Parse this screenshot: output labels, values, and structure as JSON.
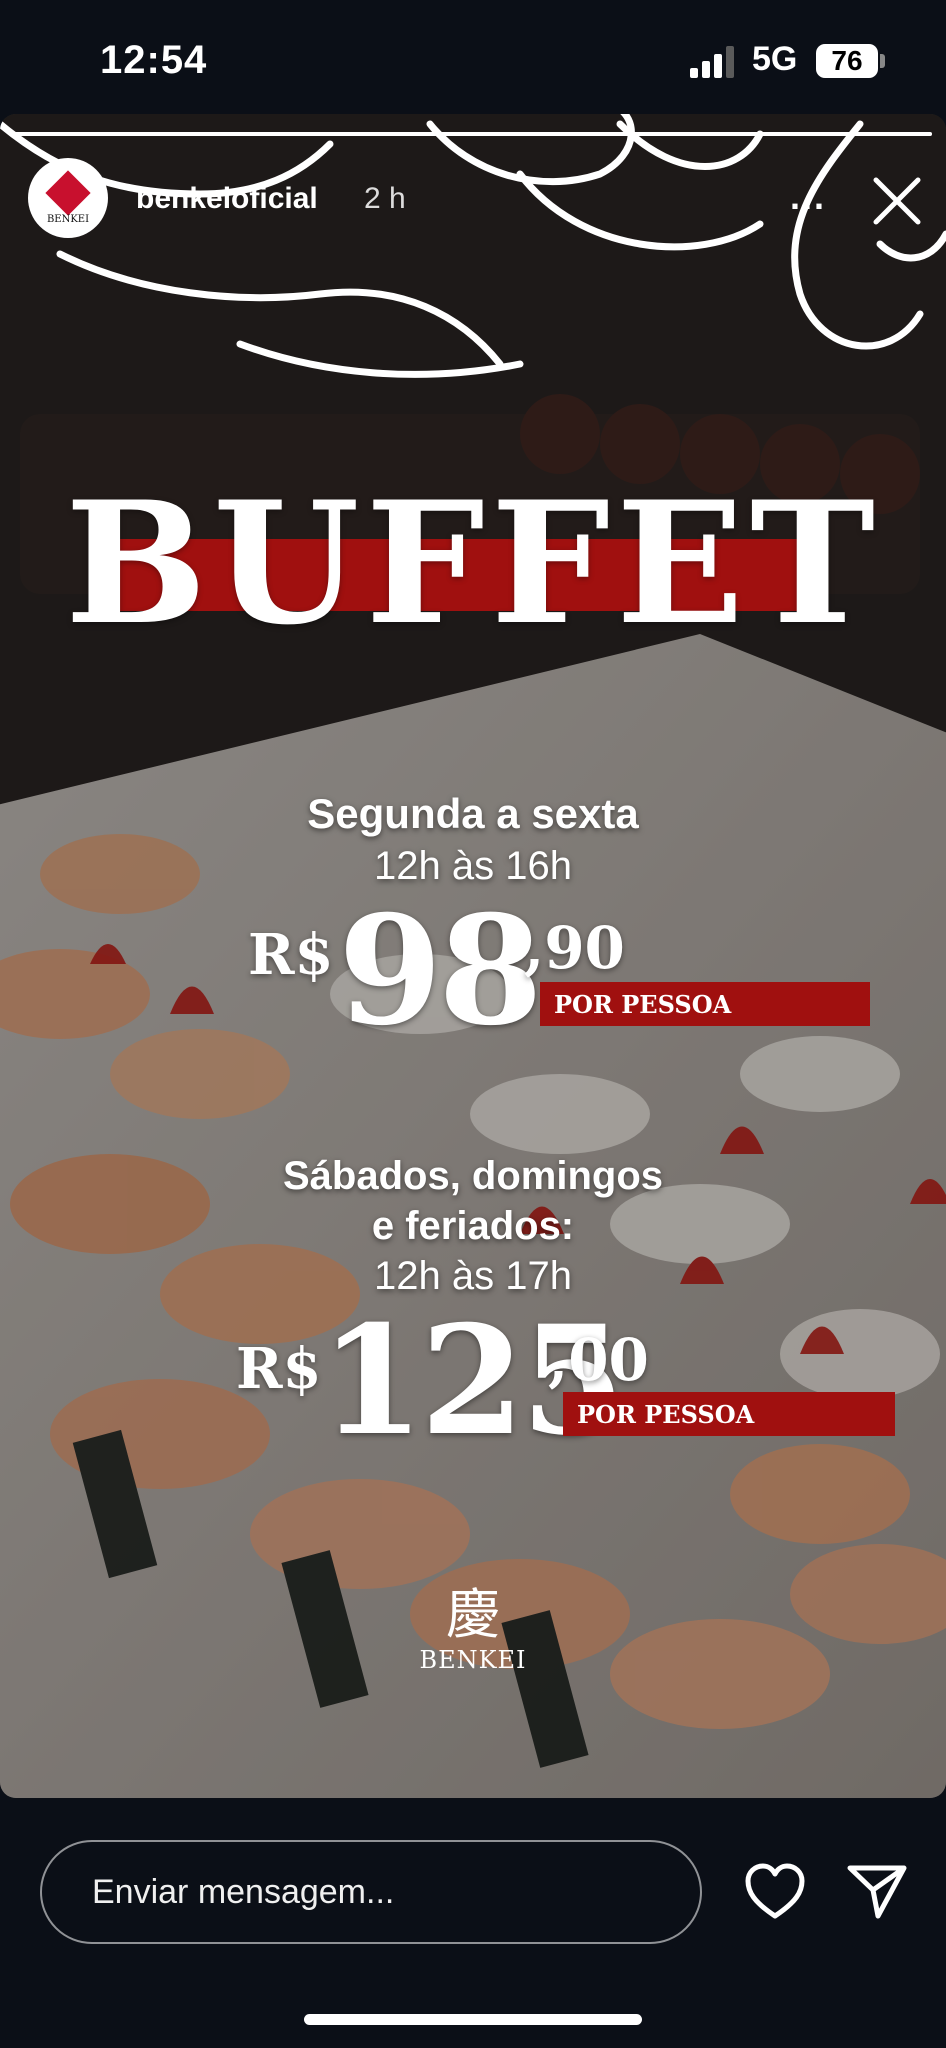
{
  "status_bar": {
    "time": "12:54",
    "network": "5G",
    "battery": "76"
  },
  "story": {
    "progress": 1.0,
    "account": {
      "username": "benkeioficial",
      "posted": "2 h",
      "avatar_text": "BENKEI",
      "avatar_color": "#c8102e"
    },
    "more_label": "...",
    "content": {
      "title": "BUFFET",
      "weekday": {
        "days": "Segunda a sexta",
        "hours": "12h às 16h",
        "currency": "R$",
        "amount": "98",
        "cents": ",90",
        "unit": "POR PESSOA"
      },
      "weekend": {
        "days_line1": "Sábados, domingos",
        "days_line2": "e feriados:",
        "hours": "12h às 17h",
        "currency": "R$",
        "amount": "125",
        "cents": ",00",
        "unit": "POR PESSOA"
      },
      "logo_glyph": "慶",
      "logo_name": "BENKEI"
    }
  },
  "reply": {
    "placeholder": "Enviar mensagem..."
  },
  "colors": {
    "accent_red": "#a0100f",
    "background": "#0b0f17"
  },
  "icons": {
    "like": "heart-icon",
    "share": "send-icon",
    "close": "close-icon"
  }
}
